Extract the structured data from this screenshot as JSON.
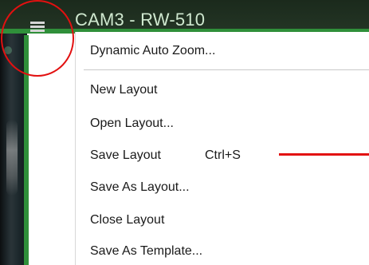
{
  "window": {
    "camera_title": "CAM3 - RW-510",
    "menu_icon": "hamburger-menu-icon"
  },
  "context_menu": {
    "items": [
      {
        "label": "Dynamic Auto Zoom...",
        "shortcut": ""
      },
      {
        "label": "New Layout",
        "shortcut": ""
      },
      {
        "label": "Open Layout...",
        "shortcut": ""
      },
      {
        "label": "Save Layout",
        "shortcut": "Ctrl+S"
      },
      {
        "label": "Save As Layout...",
        "shortcut": ""
      },
      {
        "label": "Close Layout",
        "shortcut": ""
      },
      {
        "label": "Save As Template...",
        "shortcut": ""
      }
    ]
  },
  "annotations": {
    "highlight_color": "#e21010",
    "frame_color": "#2f8f3a"
  }
}
